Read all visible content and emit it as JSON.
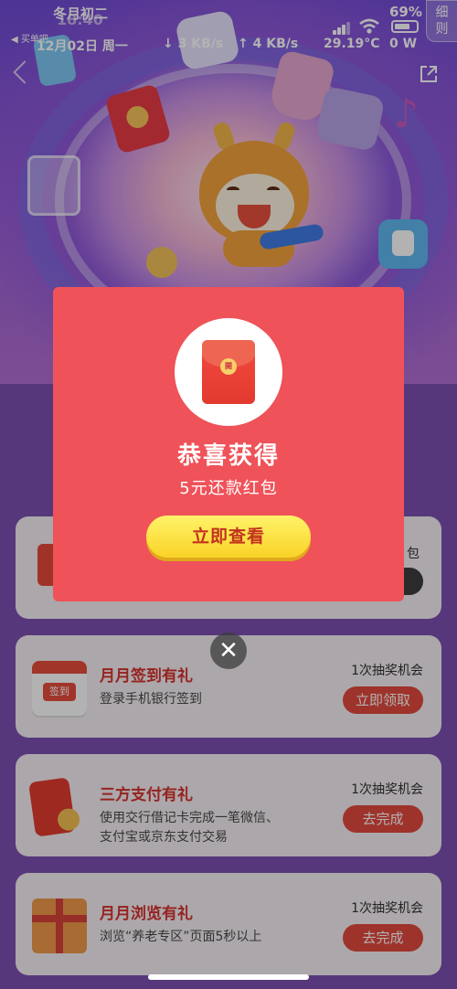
{
  "status_bar": {
    "lunar_date": "冬月初二",
    "time": "18:40",
    "back_app": "◀ 买单吧",
    "date": "12月02日 周一",
    "download": "↓ 3 KB/s",
    "upload": "↑ 4 KB/s",
    "temperature": "29.19°C",
    "power": "0 W",
    "battery_percent": "69%"
  },
  "header": {
    "rules_tab": "细\n则"
  },
  "tasks": [
    {
      "title": "",
      "desc": "",
      "chance": "包",
      "button": ""
    },
    {
      "title": "月月签到有礼",
      "desc": "登录手机银行签到",
      "chance": "1次抽奖机会",
      "button": "立即领取",
      "thumb_text": "签到"
    },
    {
      "title": "三方支付有礼",
      "desc": "使用交行借记卡完成一笔微信、支付宝或京东支付交易",
      "chance": "1次抽奖机会",
      "button": "去完成"
    },
    {
      "title": "月月浏览有礼",
      "desc": "浏览“养老专区”页面5秒以上",
      "chance": "1次抽奖机会",
      "button": "去完成"
    }
  ],
  "modal": {
    "title": "恭喜获得",
    "prize": "5元还款红包",
    "button": "立即查看",
    "envelope_seal": "開",
    "close": "✕"
  },
  "colors": {
    "modal_bg": "#ef5259",
    "button_yellow": "#f9d326",
    "task_title_red": "#d6332f",
    "task_button_red": "#e24a3e"
  },
  "icons": [
    "signal-icon",
    "wifi-icon",
    "battery-icon",
    "back-chevron-icon",
    "share-icon",
    "red-envelope-icon",
    "close-icon",
    "calendar-icon",
    "payment-icon",
    "gift-box-icon"
  ]
}
